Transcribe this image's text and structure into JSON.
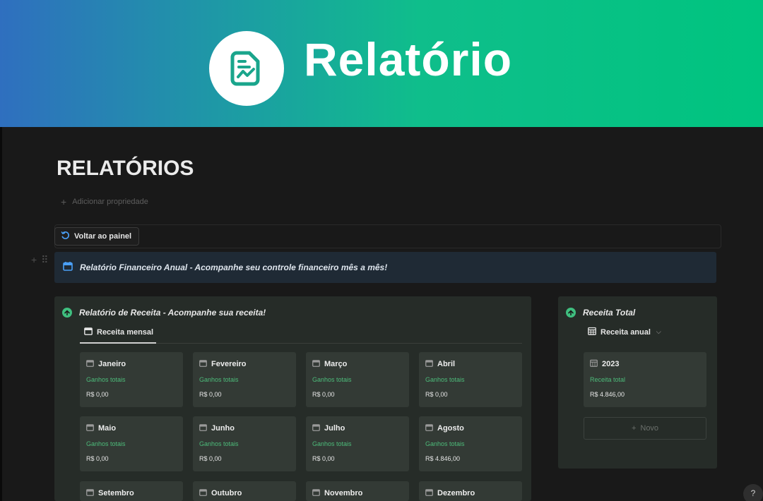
{
  "banner": {
    "title": "Relatório",
    "logo_icon": "report-chart-icon"
  },
  "page": {
    "title": "RELATÓRIOS",
    "add_property": "Adicionar propriedade"
  },
  "toolbar": {
    "back_label": "Voltar ao painel",
    "back_icon": "undo-icon"
  },
  "callout": {
    "icon": "calendar-icon",
    "text": "Relatório Financeiro Anual - Acompanhe seu controle financeiro mês a mês!"
  },
  "main_panel": {
    "title": "Relatório de Receita - Acompanhe sua receita!",
    "tab_label": "Receita mensal",
    "cards": [
      {
        "month": "Janeiro",
        "subtitle": "Ganhos totais",
        "value": "R$ 0,00"
      },
      {
        "month": "Fevereiro",
        "subtitle": "Ganhos totais",
        "value": "R$ 0,00"
      },
      {
        "month": "Março",
        "subtitle": "Ganhos totais",
        "value": "R$ 0,00"
      },
      {
        "month": "Abril",
        "subtitle": "Ganhos totais",
        "value": "R$ 0,00"
      },
      {
        "month": "Maio",
        "subtitle": "Ganhos totais",
        "value": "R$ 0,00"
      },
      {
        "month": "Junho",
        "subtitle": "Ganhos totais",
        "value": "R$ 0,00"
      },
      {
        "month": "Julho",
        "subtitle": "Ganhos totais",
        "value": "R$ 0,00"
      },
      {
        "month": "Agosto",
        "subtitle": "Ganhos totais",
        "value": "R$ 4.846,00"
      },
      {
        "month": "Setembro",
        "subtitle": "",
        "value": ""
      },
      {
        "month": "Outubro",
        "subtitle": "",
        "value": ""
      },
      {
        "month": "Novembro",
        "subtitle": "",
        "value": ""
      },
      {
        "month": "Dezembro",
        "subtitle": "",
        "value": ""
      }
    ]
  },
  "side_panel": {
    "title": "Receita Total",
    "tab_label": "Receita anual",
    "card": {
      "year": "2023",
      "subtitle": "Receita total",
      "value": "R$ 4.846,00"
    },
    "new_label": "Novo"
  },
  "help": {
    "label": "?"
  },
  "colors": {
    "accent_green": "#3fbf7f",
    "accent_blue": "#4a9ff5",
    "banner_start": "#2f6fbf",
    "banner_end": "#00c47f"
  }
}
